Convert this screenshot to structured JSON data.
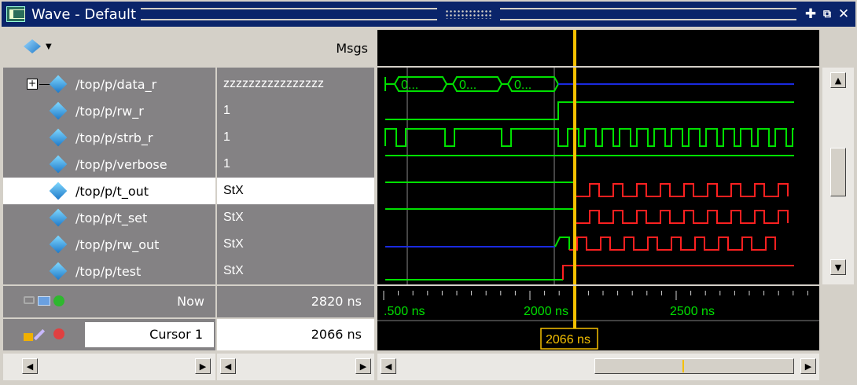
{
  "window": {
    "title": "Wave - Default"
  },
  "columns": {
    "msgs_header": "Msgs"
  },
  "signals": [
    {
      "name": "/top/p/data_r",
      "value": "zzzzzzzzzzzzzzzz",
      "expandable": true
    },
    {
      "name": "/top/p/rw_r",
      "value": "1"
    },
    {
      "name": "/top/p/strb_r",
      "value": "1"
    },
    {
      "name": "/top/p/verbose",
      "value": "1"
    },
    {
      "name": "/top/p/t_out",
      "value": "StX",
      "selected": true
    },
    {
      "name": "/top/p/t_set",
      "value": "StX"
    },
    {
      "name": "/top/p/rw_out",
      "value": "StX"
    },
    {
      "name": "/top/p/test",
      "value": "StX"
    }
  ],
  "bus_segments": [
    "0...",
    "0...",
    "0..."
  ],
  "footer": {
    "now_label": "Now",
    "now_value": "2820 ns",
    "cursor_label": "Cursor 1",
    "cursor_value": "2066 ns"
  },
  "time_axis": {
    "labels": [
      ".500 ns",
      "2000 ns",
      "2500 ns"
    ],
    "cursor_readout": "2066 ns"
  },
  "colors": {
    "wave_green": "#00e000",
    "wave_blue": "#1a2ae0",
    "wave_red": "#ff2020",
    "cursor": "#f5c000",
    "title_bar": "#0a246a"
  },
  "icons": [
    "signal-diamond-icon",
    "maximize-icon",
    "undock-icon",
    "close-icon"
  ]
}
